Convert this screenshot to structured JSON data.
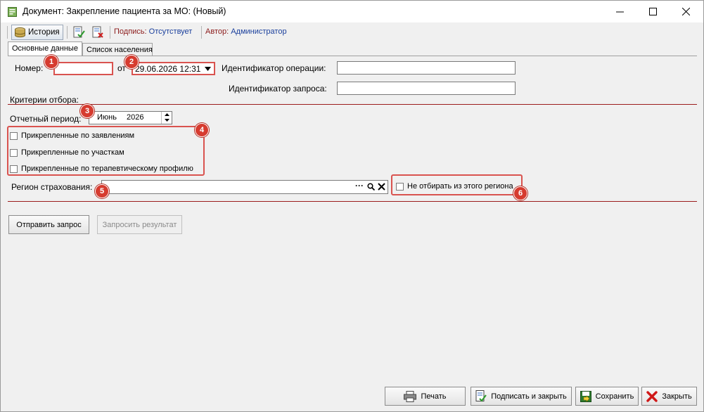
{
  "window": {
    "title": "Документ: Закрепление пациента за МО:  (Новый)",
    "minimize_glyph": "—",
    "maximize_glyph": "☐",
    "close_glyph": "✕"
  },
  "toolbar": {
    "history_label": "История",
    "signature_label": "Подпись: ",
    "signature_value": "Отсутствует",
    "author_label": "Автор: ",
    "author_value": "Администратор"
  },
  "tabs": [
    {
      "label": "Основные данные",
      "active": true
    },
    {
      "label": "Список населения",
      "active": false
    }
  ],
  "form": {
    "number_label": "Номер:",
    "number_value": "",
    "from_label": "от",
    "date_value": "29.06.2026 12:31",
    "operation_id_label": "Идентификатор операции:",
    "operation_id_value": "",
    "request_id_label": "Идентификатор запроса:",
    "request_id_value": "",
    "criteria_label": "Критерии отбора:",
    "period_label": "Отчетный период:",
    "period_month": "Июнь",
    "period_year": "2026",
    "checkboxes": [
      {
        "label": "Прикрепленные по заявлениям",
        "checked": false
      },
      {
        "label": "Прикрепленные по участкам",
        "checked": false
      },
      {
        "label": "Прикрепленные по терапевтическому профилю",
        "checked": false
      }
    ],
    "region_label": "Регион страхования:",
    "region_value": "",
    "region_dots": "···",
    "exclude_region_label": "Не отбирать из этого региона",
    "send_request_label": "Отправить запрос",
    "request_result_label": "Запросить результат"
  },
  "footer": {
    "print_label": "Печать",
    "sign_close_label": "Подписать и закрыть",
    "save_label": "Сохранить",
    "close_label": "Закрыть"
  },
  "callouts": [
    "1",
    "2",
    "3",
    "4",
    "5",
    "6"
  ],
  "colors": {
    "accent_red": "#d63b2f",
    "divider": "#9b1c1c",
    "signature_value": "#1a3f9c",
    "label_dark_red": "#8b1a1a"
  }
}
